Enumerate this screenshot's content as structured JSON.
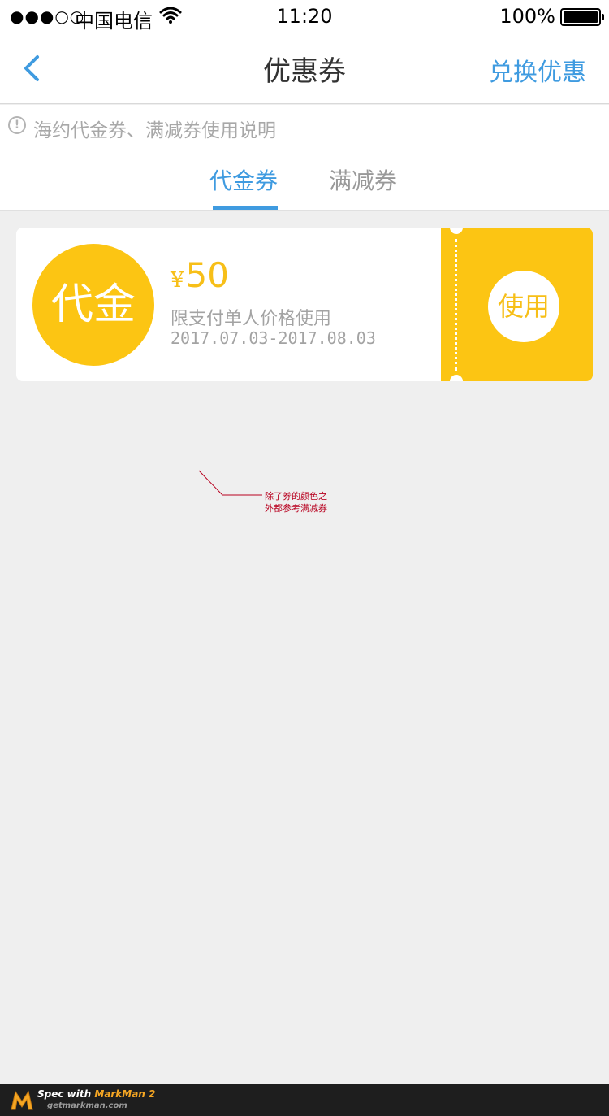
{
  "status_bar": {
    "signal": "●●●○○",
    "carrier": "中国电信",
    "time": "11:20",
    "battery": "100%"
  },
  "nav": {
    "title": "优惠券",
    "action": "兑换优惠"
  },
  "notice": {
    "text": "海约代金券、满减券使用说明"
  },
  "tabs": [
    {
      "label": "代金券",
      "active": true
    },
    {
      "label": "满减券",
      "active": false
    }
  ],
  "coupon": {
    "badge": "代金",
    "currency": "¥",
    "amount": "50",
    "description": "限支付单人价格使用",
    "validity": "2017.07.03-2017.08.03",
    "button": "使用",
    "color": "#fcc513"
  },
  "annotation": {
    "line1": "除了券的颜色之",
    "line2": "外都参考满减券"
  },
  "footer": {
    "spec_prefix": "Spec with ",
    "brand": "MarkMan 2",
    "site": "getmarkman.com"
  },
  "colors": {
    "accent": "#3f9be0",
    "coupon": "#fcc513",
    "background": "#efefef"
  }
}
